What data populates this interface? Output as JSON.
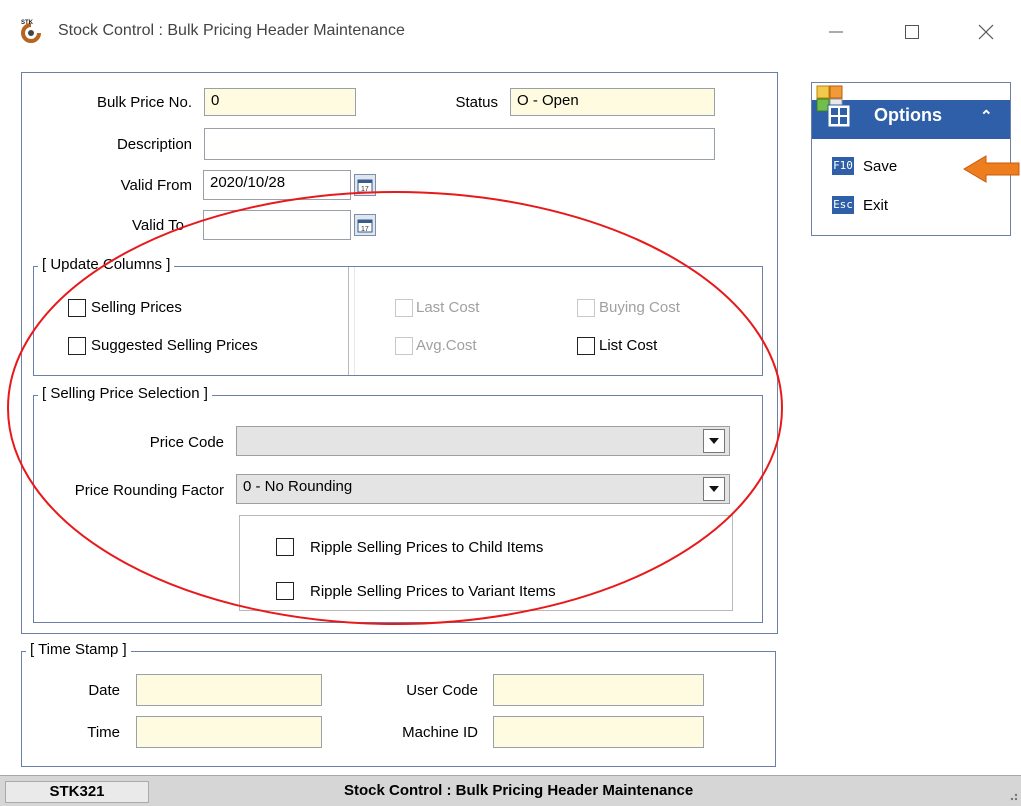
{
  "window": {
    "title": "Stock Control : Bulk Pricing Header Maintenance",
    "app_icon_text": "STK",
    "minimize_glyph": "—",
    "maximize_glyph": "☐",
    "close_glyph": "✕"
  },
  "header_fields": {
    "bulk_price_no_label": "Bulk Price No.",
    "bulk_price_no_value": "0",
    "status_label": "Status",
    "status_value": "O - Open",
    "description_label": "Description",
    "description_value": "",
    "valid_from_label": "Valid From",
    "valid_from_value": "2020/10/28",
    "valid_to_label": "Valid To",
    "valid_to_value": ""
  },
  "update_columns": {
    "title": "[ Update Columns ]",
    "selling_prices": "Selling Prices",
    "suggested_selling_prices": "Suggested Selling Prices",
    "last_cost": "Last Cost",
    "avg_cost": "Avg.Cost",
    "buying_cost": "Buying Cost",
    "list_cost": "List Cost"
  },
  "selling_price_selection": {
    "title": "[ Selling Price Selection ]",
    "price_code_label": "Price Code",
    "price_code_value": "",
    "rounding_label": "Price Rounding Factor",
    "rounding_value": "0 - No Rounding",
    "ripple_child": "Ripple Selling Prices to Child Items",
    "ripple_variant": "Ripple Selling Prices to Variant Items"
  },
  "time_stamp": {
    "title": "[ Time Stamp ]",
    "date_label": "Date",
    "time_label": "Time",
    "user_code_label": "User Code",
    "machine_id_label": "Machine ID",
    "date_value": "",
    "time_value": "",
    "user_code_value": "",
    "machine_id_value": ""
  },
  "options": {
    "title": "Options",
    "collapse_glyph": "⌃",
    "items": [
      {
        "key": "F10",
        "label": "Save"
      },
      {
        "key": "Esc",
        "label": "Exit"
      }
    ]
  },
  "status_bar": {
    "code": "STK321",
    "title": "Stock Control : Bulk Pricing Header Maintenance"
  },
  "colors": {
    "accent_blue": "#2e5fa8",
    "field_yellow": "#fffbe0",
    "annotation_red": "#e8191a",
    "arrow_orange": "#ee7d1e"
  }
}
